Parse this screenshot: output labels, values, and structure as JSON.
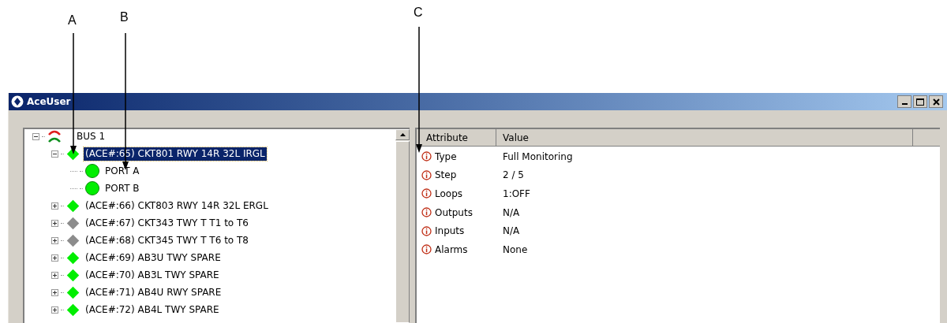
{
  "callouts": [
    {
      "label": "A"
    },
    {
      "label": "B"
    },
    {
      "label": "C"
    }
  ],
  "window": {
    "title": "AceUser"
  },
  "tree": [
    {
      "label": "BUS 1",
      "kind": "bus",
      "expanded": true,
      "selected": false,
      "children": [
        {
          "label": "(ACE#:65) CKT801 RWY 14R 32L IRGL",
          "kind": "unit",
          "color": "#00ee00",
          "expanded": true,
          "selected": true,
          "children": [
            {
              "label": "PORT A",
              "kind": "port",
              "color": "#00ee00",
              "selected": false
            },
            {
              "label": "PORT B",
              "kind": "port",
              "color": "#00ee00",
              "selected": false
            }
          ]
        },
        {
          "label": "(ACE#:66) CKT803 RWY 14R 32L ERGL",
          "kind": "unit",
          "color": "#00ee00",
          "expanded": false,
          "selected": false
        },
        {
          "label": "(ACE#:67) CKT343 TWY T T1 to T6",
          "kind": "unit",
          "color": "#8c8c8c",
          "expanded": false,
          "selected": false
        },
        {
          "label": "(ACE#:68) CKT345 TWY T T6 to T8",
          "kind": "unit",
          "color": "#8c8c8c",
          "expanded": false,
          "selected": false
        },
        {
          "label": "(ACE#:69) AB3U TWY SPARE",
          "kind": "unit",
          "color": "#00ee00",
          "expanded": false,
          "selected": false
        },
        {
          "label": "(ACE#:70) AB3L TWY SPARE",
          "kind": "unit",
          "color": "#00ee00",
          "expanded": false,
          "selected": false
        },
        {
          "label": "(ACE#:71) AB4U RWY SPARE",
          "kind": "unit",
          "color": "#00ee00",
          "expanded": false,
          "selected": false
        },
        {
          "label": "(ACE#:72) AB4L TWY SPARE",
          "kind": "unit",
          "color": "#00ee00",
          "expanded": false,
          "selected": false
        }
      ]
    }
  ],
  "attributes": {
    "columns": [
      "Attribute",
      "Value"
    ],
    "rows": [
      {
        "attribute": "Type",
        "value": "Full Monitoring"
      },
      {
        "attribute": "Step",
        "value": "2 / 5"
      },
      {
        "attribute": "Loops",
        "value": "1:OFF"
      },
      {
        "attribute": "Outputs",
        "value": "N/A"
      },
      {
        "attribute": "Inputs",
        "value": "N/A"
      },
      {
        "attribute": "Alarms",
        "value": "None"
      }
    ]
  }
}
